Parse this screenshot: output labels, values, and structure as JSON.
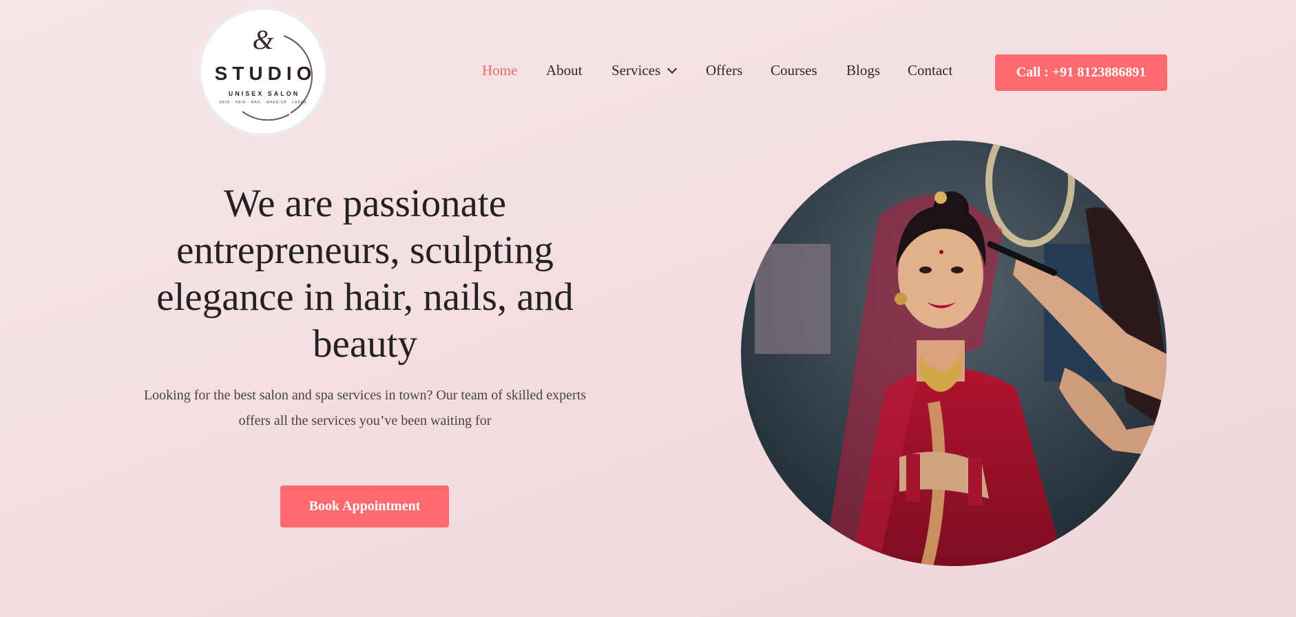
{
  "logo": {
    "monogram": "&#38;",
    "name": "STUDIO",
    "subtitle": "UNISEX SALON",
    "tagline": "SKIN · HAIR · NAIL · MAKE-UP · LASER"
  },
  "nav": {
    "items": [
      {
        "label": "Home",
        "active": true
      },
      {
        "label": "About"
      },
      {
        "label": "Services"
      },
      {
        "label": "Offers"
      },
      {
        "label": "Courses"
      },
      {
        "label": "Blogs"
      },
      {
        "label": "Contact"
      }
    ],
    "call_label": "Call : +91 8123886891"
  },
  "hero": {
    "title": "We are passionate entrepreneurs, sculpting elegance in hair, nails, and beauty",
    "subtitle": "Looking for the best salon and spa services in town? Our team of skilled experts offers all the services you’ve been waiting for",
    "button_label": "Book Appointment"
  },
  "colors": {
    "accent": "#fd6b6f",
    "active_nav": "#e26c6c",
    "background": "#f5e0e3"
  }
}
